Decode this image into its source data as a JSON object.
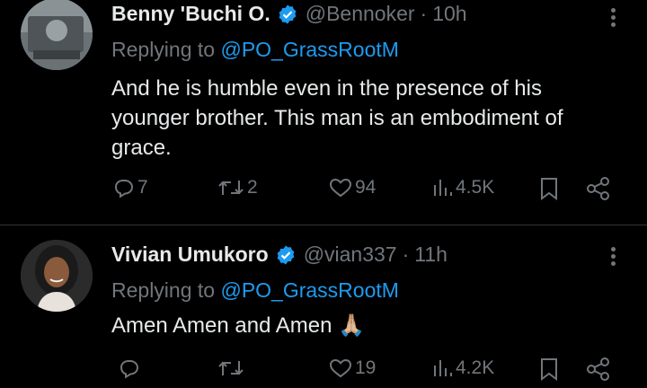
{
  "tweets": [
    {
      "name": "Benny 'Buchi O.",
      "handle": "@Bennoker",
      "separator": "·",
      "time": "10h",
      "reply_prefix": "Replying to",
      "reply_mention": "@PO_GrassRootM",
      "text": "And he is humble even in the presence of his younger brother. This man is an embodiment of grace.",
      "replies": "7",
      "retweets": "2",
      "likes": "94",
      "views": "4.5K",
      "icons": [
        "reply-icon",
        "retweet-icon",
        "like-icon",
        "views-icon",
        "bookmark-icon",
        "share-icon"
      ]
    },
    {
      "name": "Vivian Umukoro",
      "handle": "@vian337",
      "separator": "·",
      "time": "11h",
      "reply_prefix": "Replying to",
      "reply_mention": "@PO_GrassRootM",
      "text": "Amen Amen and Amen",
      "emoji": "🙏🏼",
      "replies": "",
      "retweets": "",
      "likes": "19",
      "views": "4.2K",
      "icons": [
        "reply-icon",
        "retweet-icon",
        "like-icon",
        "views-icon",
        "bookmark-icon",
        "share-icon"
      ]
    }
  ],
  "colors": {
    "background": "#000000",
    "text": "#e7e9ea",
    "muted": "#71767b",
    "accent": "#1d9bf0",
    "divider": "#2f3336"
  }
}
